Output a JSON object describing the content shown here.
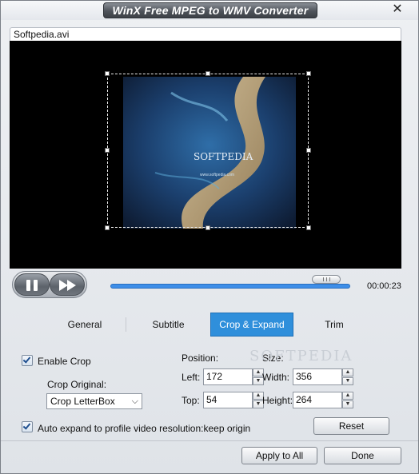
{
  "window": {
    "title": "WinX Free MPEG to WMV Converter"
  },
  "file_tab": {
    "name": "Softpedia.avi"
  },
  "preview": {
    "frame_watermark": "SOFTPEDIA",
    "frame_url": "www.softpedia.com"
  },
  "player": {
    "timecode": "00:00:23",
    "progress": 0.9
  },
  "tabs": [
    {
      "label": "General",
      "active": false
    },
    {
      "label": "Subtitle",
      "active": false
    },
    {
      "label": "Crop & Expand",
      "active": true
    },
    {
      "label": "Trim",
      "active": false
    }
  ],
  "crop": {
    "enable_label": "Enable Crop",
    "enable_checked": true,
    "original_label": "Crop Original:",
    "original_value": "Crop LetterBox",
    "position_label": "Position:",
    "size_label": "Size:",
    "left_label": "Left:",
    "left_value": "172",
    "top_label": "Top:",
    "top_value": "54",
    "width_label": "Width:",
    "width_value": "356",
    "height_label": "Height:",
    "height_value": "264",
    "auto_expand_label": "Auto expand to profile video resolution:keep origin",
    "auto_expand_checked": true,
    "reset_label": "Reset",
    "watermark": "SOFTPEDIA"
  },
  "footer": {
    "apply_label": "Apply to All",
    "done_label": "Done"
  },
  "colors": {
    "active_tab": "#2f8fdb",
    "progress": "#3d8ee8"
  }
}
